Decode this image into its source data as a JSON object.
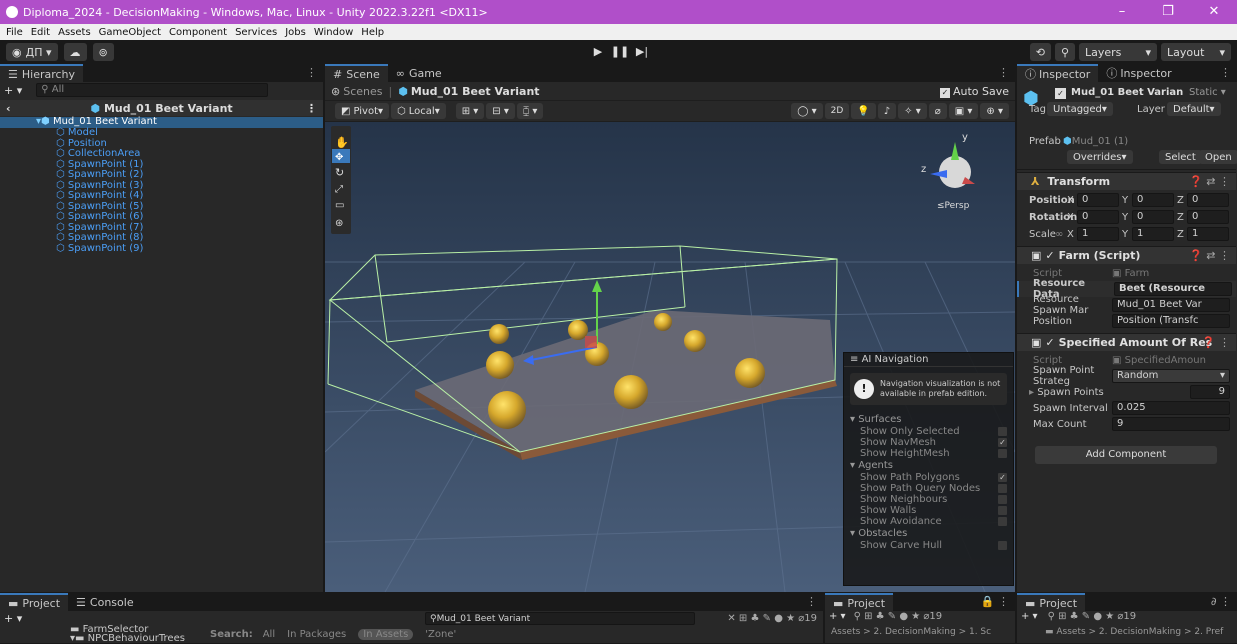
{
  "window": {
    "title": "Diploma_2024 - DecisionMaking - Windows, Mac, Linux - Unity 2022.3.22f1 <DX11>",
    "minimize": "–",
    "maximize": "❐",
    "close": "✕"
  },
  "menu": [
    "File",
    "Edit",
    "Assets",
    "GameObject",
    "Component",
    "Services",
    "Jobs",
    "Window",
    "Help"
  ],
  "toolbar": {
    "account": "ДП ▾",
    "cloud": "☁",
    "collab": "⊚",
    "play": "▶",
    "pause": "❚❚",
    "step": "▶|",
    "history": "⟲",
    "search": "⚲",
    "layers": "Layers",
    "layout": "Layout"
  },
  "hierarchy": {
    "tab": "Hierarchy",
    "search_placeholder": "All",
    "add": "+ ▾",
    "scene_root": "Mud_01 Beet Variant",
    "root_item": "Mud_01 Beet Variant",
    "items": [
      "Model",
      "Position",
      "CollectionArea",
      "SpawnPoint (1)",
      "SpawnPoint (2)",
      "SpawnPoint (3)",
      "SpawnPoint (4)",
      "SpawnPoint (5)",
      "SpawnPoint (6)",
      "SpawnPoint (7)",
      "SpawnPoint (8)",
      "SpawnPoint (9)"
    ]
  },
  "scene": {
    "tab_scene": "Scene",
    "tab_game": "Game",
    "breadcrumb_scenes": "Scenes",
    "breadcrumb_prefab": "Mud_01 Beet Variant",
    "auto_save": "Auto Save",
    "pivot": "Pivot",
    "local": "Local",
    "mode_2d": "2D",
    "persp": "≤Persp",
    "gizmo_y": "y",
    "gizmo_z": "z"
  },
  "ai_navigation": {
    "title": "AI Navigation",
    "warning": "Navigation visualization is not available in prefab edition.",
    "surfaces": "Surfaces",
    "surface_items": [
      {
        "label": "Show Only Selected",
        "checked": ""
      },
      {
        "label": "Show NavMesh",
        "checked": "✓"
      },
      {
        "label": "Show HeightMesh",
        "checked": ""
      }
    ],
    "agents": "Agents",
    "agent_items": [
      {
        "label": "Show Path Polygons",
        "checked": "✓"
      },
      {
        "label": "Show Path Query Nodes",
        "checked": ""
      },
      {
        "label": "Show Neighbours",
        "checked": ""
      },
      {
        "label": "Show Walls",
        "checked": ""
      },
      {
        "label": "Show Avoidance",
        "checked": ""
      }
    ],
    "obstacles": "Obstacles",
    "obstacle_items": [
      {
        "label": "Show Carve Hull",
        "checked": ""
      }
    ]
  },
  "inspector": {
    "tab1": "Inspector",
    "tab2": "Inspector",
    "object_name": "Mud_01 Beet Varian",
    "static": "Static",
    "tag_label": "Tag",
    "tag_value": "Untagged",
    "layer_label": "Layer",
    "layer_value": "Default",
    "prefab_label": "Prefab",
    "prefab_value": "Mud_01 (1)",
    "overrides": "Overrides",
    "select": "Select",
    "open": "Open",
    "transform": {
      "title": "Transform",
      "position": "Position",
      "rotation": "Rotation",
      "scale": "Scale",
      "pos": [
        "0",
        "0",
        "0"
      ],
      "rot": [
        "0",
        "0",
        "0"
      ],
      "scl": [
        "1",
        "1",
        "1"
      ]
    },
    "farm": {
      "title": "Farm (Script)",
      "script_label": "Script",
      "script_value": "Farm",
      "resource_data_label": "Resource Data",
      "resource_data_value": "Beet (Resource",
      "spawn_manager_label": "Resource Spawn Mar",
      "spawn_manager_value": "Mud_01 Beet Var",
      "position_label": "Position",
      "position_value": "Position (Transfc"
    },
    "specified": {
      "title": "Specified Amount Of Res",
      "script_label": "Script",
      "script_value": "SpecifiedAmoun",
      "strategy_label": "Spawn Point Strateg",
      "strategy_value": "Random",
      "spawn_points_label": "Spawn Points",
      "spawn_points_value": "9",
      "interval_label": "Spawn Interval",
      "interval_value": "0.025",
      "max_count_label": "Max Count",
      "max_count_value": "9"
    },
    "add_component": "Add Component"
  },
  "bottom": {
    "tab_project": "Project",
    "tab_console": "Console",
    "search_value": "Mud_01 Beet Variant",
    "count": "19",
    "folders": [
      "FarmSelector",
      "NPCBehaviourTrees"
    ],
    "search_label": "Search:",
    "scope_all": "All",
    "scope_packages": "In Packages",
    "scope_assets": "In Assets",
    "query": "'Zone'",
    "project2_tab": "Project",
    "project2_path": "Assets > 2. DecisionMaking > 1. Sc",
    "project3_tab": "Project",
    "project3_path": "Assets > 2. DecisionMaking > 2. Pref",
    "count2": "19",
    "count3": "19"
  },
  "colors": {
    "title_bar": "#b04fc9",
    "accent_blue": "#4b9ef6",
    "scene_bg": "#3a4d6a"
  }
}
